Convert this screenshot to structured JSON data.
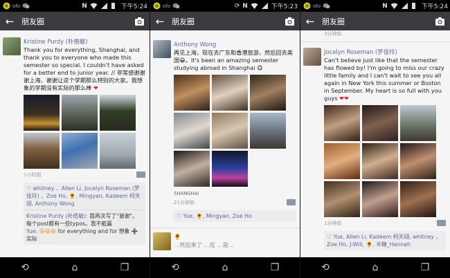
{
  "status_bars": [
    {
      "time": "下午5:24"
    },
    {
      "time": "下午5:23"
    },
    {
      "time": "下午5:24"
    }
  ],
  "app": {
    "title": "朋友圈"
  },
  "panel1": {
    "post": {
      "author": "Kristine Purdy (朴皓敏)",
      "text": "Thank you for everything, Shanghai, and thank you to everyone who made this semester so special. I couldn't have asked for a better end to junior year. // 非常感谢谢谢上海，谢谢让这个学期那么特别的大家。我想象的学期没有实际的那么棒",
      "time": "1小时前",
      "likes": "whitney 、Allen Li, Jocelyn Roseman (罗佳玲) 、Zoe Ho, 🌻, Mingyan, Kadeem 柯天翊, Anthony Wong",
      "comment1_name": "Kristine Purdy (朴皓敏):",
      "comment1_text": "我再次写了\"谢谢\"。每个post都有一些typos。我不能赢",
      "comment2_name": "Yue:",
      "comment2_text": "for everything and for 想象 ➕实际"
    }
  },
  "panel2": {
    "post": {
      "author": "Anthony Wong",
      "text": "再见上海，现在去广东和香港旅游，然后回去美国😀。It's been an amazing semester studying abroad in Shanghai 😋",
      "location": "SHANGHAI",
      "time": "21分钟前",
      "likes": "Yue, 🌻, Mingyan, Zoe Ho",
      "next_author": "🌻",
      "next_text": "…然后来了 …在 …是…"
    }
  },
  "panel3": {
    "top_time": "3分钟前",
    "post": {
      "author": "Jocelyn Roseman (罗佳玲)",
      "text": "Can't believe just like that the semester has flowed by! I'm going to miss our crazy little family and I can't wait to see you all again in New York this summer or Boston in September. My heart is so full with you guys",
      "time": "1分钟前",
      "likes": "Yue, Allen Li, Kadeem 柯天翊, whitney 、Zoe Ho, J-Will, 🌻, 半糖_Hannah"
    }
  },
  "colors": {
    "appbar": "#3a3a3f",
    "name_link": "#576b95",
    "status_bg": "#000000"
  },
  "icons": [
    "back-arrow-icon",
    "camera-icon",
    "wifi-icon",
    "signal-icon",
    "battery-icon",
    "nfc-icon",
    "more-comment-icon",
    "like-heart-icon",
    "nav-back-icon",
    "nav-home-icon",
    "nav-recents-icon"
  ]
}
